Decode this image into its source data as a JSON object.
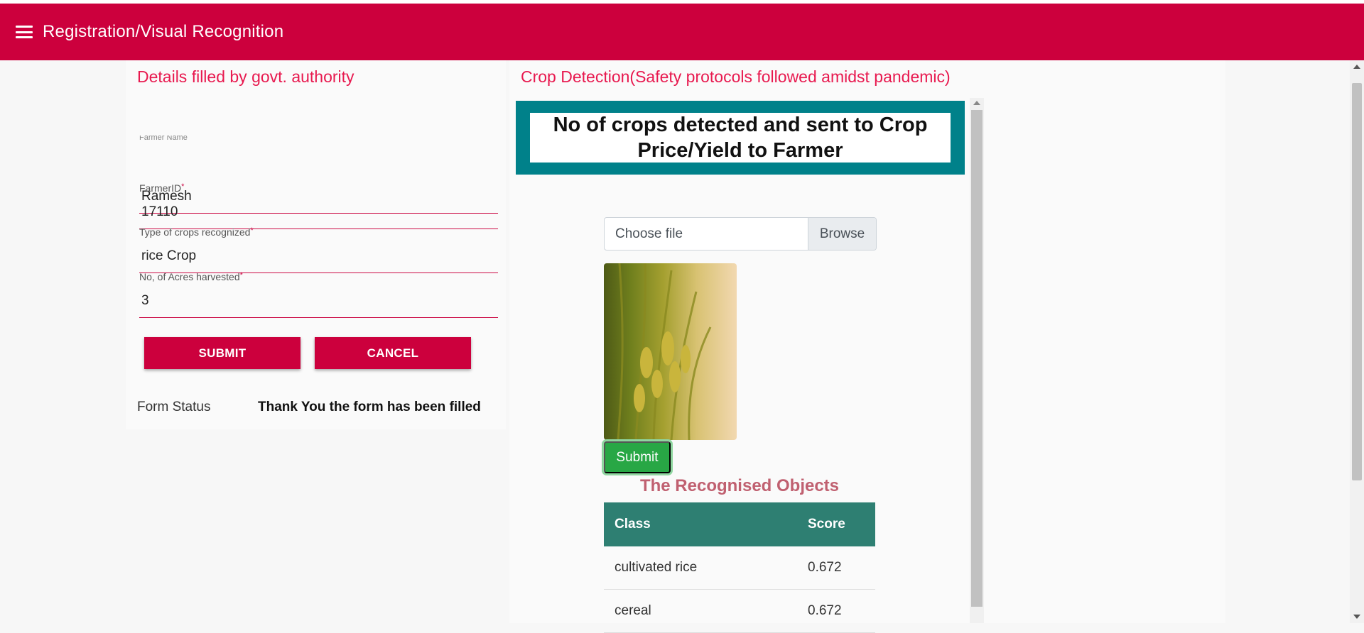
{
  "app": {
    "title": "Registration/Visual Recognition",
    "menu_icon": "hamburger-menu-icon"
  },
  "form_card": {
    "heading": "Details filled by govt. authority",
    "fields": [
      {
        "label": "Farmer Name",
        "value": "Ramesh"
      },
      {
        "label": "FarmerID",
        "value": "17110"
      },
      {
        "label": "Type of crops recognized",
        "value": "rice Crop"
      },
      {
        "label": "No, of Acres harvested",
        "value": "3"
      }
    ],
    "required_mark": "*",
    "submit_label": "SUBMIT",
    "cancel_label": "CANCEL",
    "status_label": "Form Status",
    "status_text": "Thank You the form has been filled"
  },
  "detection_card": {
    "heading": "Crop Detection(Safety protocols followed amidst pandemic)",
    "banner_text": "No of crops detected and sent to Crop Price/Yield to Farmer",
    "file_input": {
      "placeholder": "Choose file",
      "browse_label": "Browse"
    },
    "submit_label": "Submit",
    "results_title": "The Recognised Objects",
    "table": {
      "headers": [
        "Class",
        "Score"
      ],
      "rows": [
        [
          "cultivated rice",
          "0.672"
        ],
        [
          "cereal",
          "0.672"
        ]
      ]
    }
  },
  "colors": {
    "brand_red": "#cc003d",
    "heading_pink": "#e8194f",
    "banner_teal": "#00818a",
    "table_header": "#2e7f72",
    "success_green": "#28a745"
  }
}
